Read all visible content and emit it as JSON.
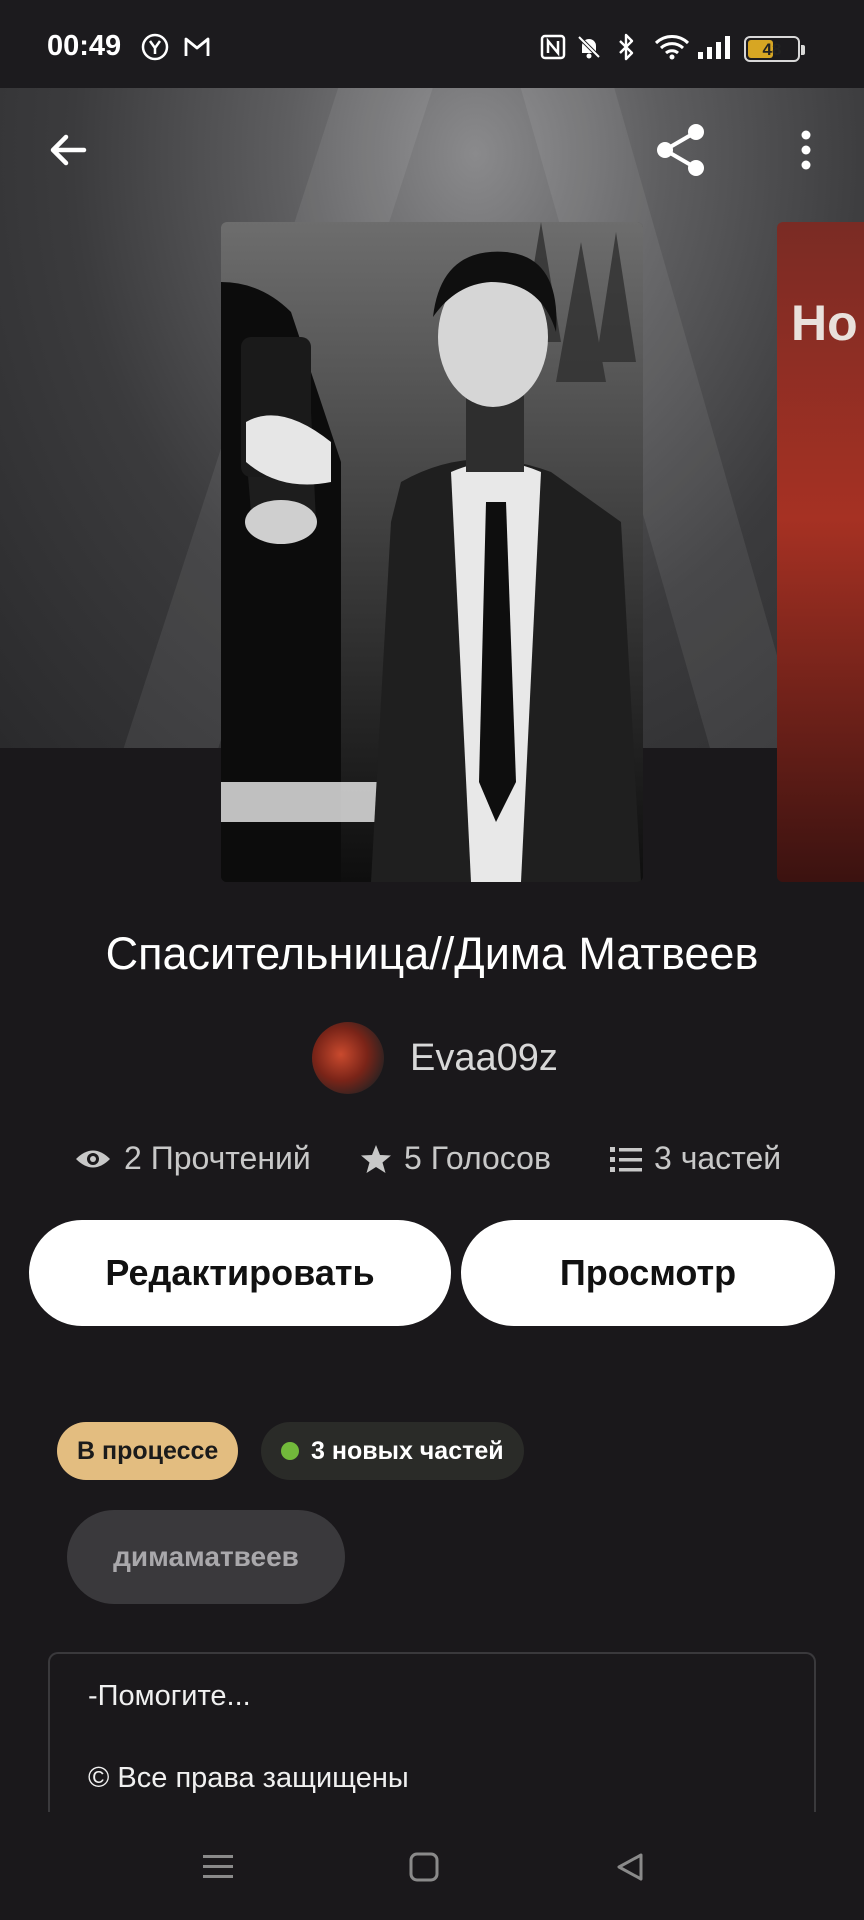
{
  "status_bar": {
    "time": "00:49",
    "battery": "48",
    "icons": [
      "yandex-icon",
      "gmail-icon",
      "nfc-icon",
      "mute-bell-icon",
      "bluetooth-icon",
      "wifi-icon",
      "signal-icon",
      "battery-icon"
    ]
  },
  "toolbar": {
    "back": "arrow-left-icon",
    "share": "share-icon",
    "more": "more-vertical-icon"
  },
  "covers": {
    "next_cover_text": "Но"
  },
  "story": {
    "title": "Спасительница//Дима Матвеев",
    "author": "Evaa09z"
  },
  "stats": {
    "reads": "2 Прочтений",
    "votes": "5 Голосов",
    "parts": "3 частей"
  },
  "actions": {
    "edit": "Редактировать",
    "preview": "Просмотр"
  },
  "badges": {
    "status": "В процессе",
    "new_parts": "3 новых частей",
    "new_dot_color": "#72b93b"
  },
  "tags": [
    "димаматвеев"
  ],
  "description": {
    "line1": "-Помогите...",
    "line2": "© Все права защищены"
  },
  "colors": {
    "background": "#1a181b",
    "status_badge": "#e3bd80",
    "button": "#ffffff"
  }
}
